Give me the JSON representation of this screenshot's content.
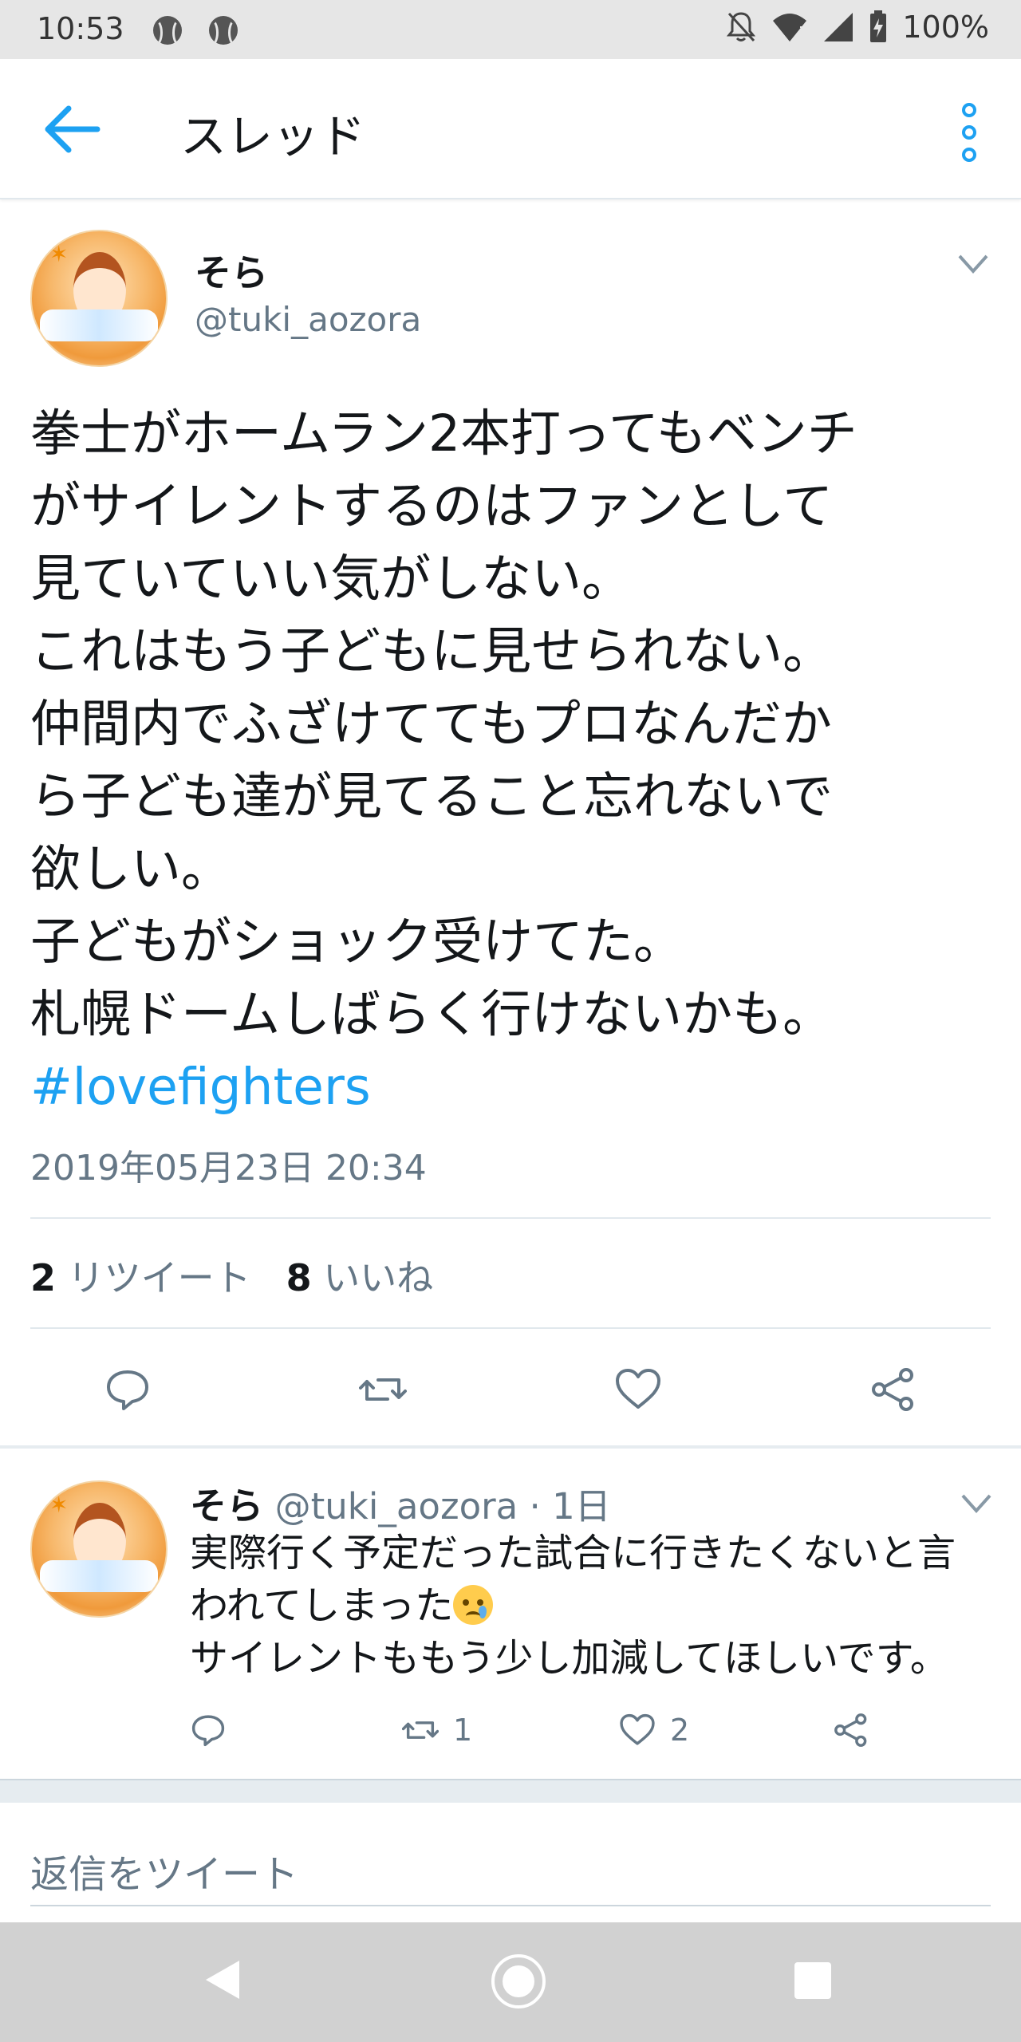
{
  "status_bar": {
    "time": "10:53",
    "battery": "100%",
    "left_icons": [
      "baseball-icon",
      "baseball-icon"
    ],
    "right_icons": [
      "notifications-off-icon",
      "wifi-icon",
      "signal-icon",
      "battery-charging-icon"
    ]
  },
  "header": {
    "title": "スレッド",
    "back_icon": "arrow-left-icon",
    "menu_icon": "more-vertical-icon",
    "accent_color": "#1da1f2"
  },
  "tweet": {
    "name": "そら",
    "handle": "@tuki_aozora",
    "lines": [
      "拳士がホームラン2本打ってもベンチ",
      "がサイレントするのはファンとして",
      "見ていていい気がしない。",
      "これはもう子どもに見せられない。",
      "仲間内でふざけててもプロなんだか",
      "ら子ども達が見てること忘れないで",
      "欲しい。",
      "子どもがショック受けてた。",
      "札幌ドームしばらく行けないかも。"
    ],
    "hashtag": "#lovefighters",
    "timestamp": "2019年05月23日 20:34",
    "retweet_count": "2",
    "retweet_label": "リツイート",
    "like_count": "8",
    "like_label": "いいね",
    "actions": [
      "reply-icon",
      "retweet-icon",
      "like-icon",
      "share-icon"
    ]
  },
  "reply": {
    "name": "そら",
    "handle": "@tuki_aozora",
    "separator": " · ",
    "time": "1日",
    "lines": [
      "実際行く予定だった試合に行きたくないと言",
      "われてしまった",
      "サイレントももう少し加減してほしいです。"
    ],
    "emoji": "crying-face-emoji",
    "retweet_count": "1",
    "like_count": "2"
  },
  "compose": {
    "placeholder": "返信をツイート"
  },
  "nav": {
    "icons": [
      "nav-back-icon",
      "nav-home-icon",
      "nav-recents-icon"
    ]
  }
}
